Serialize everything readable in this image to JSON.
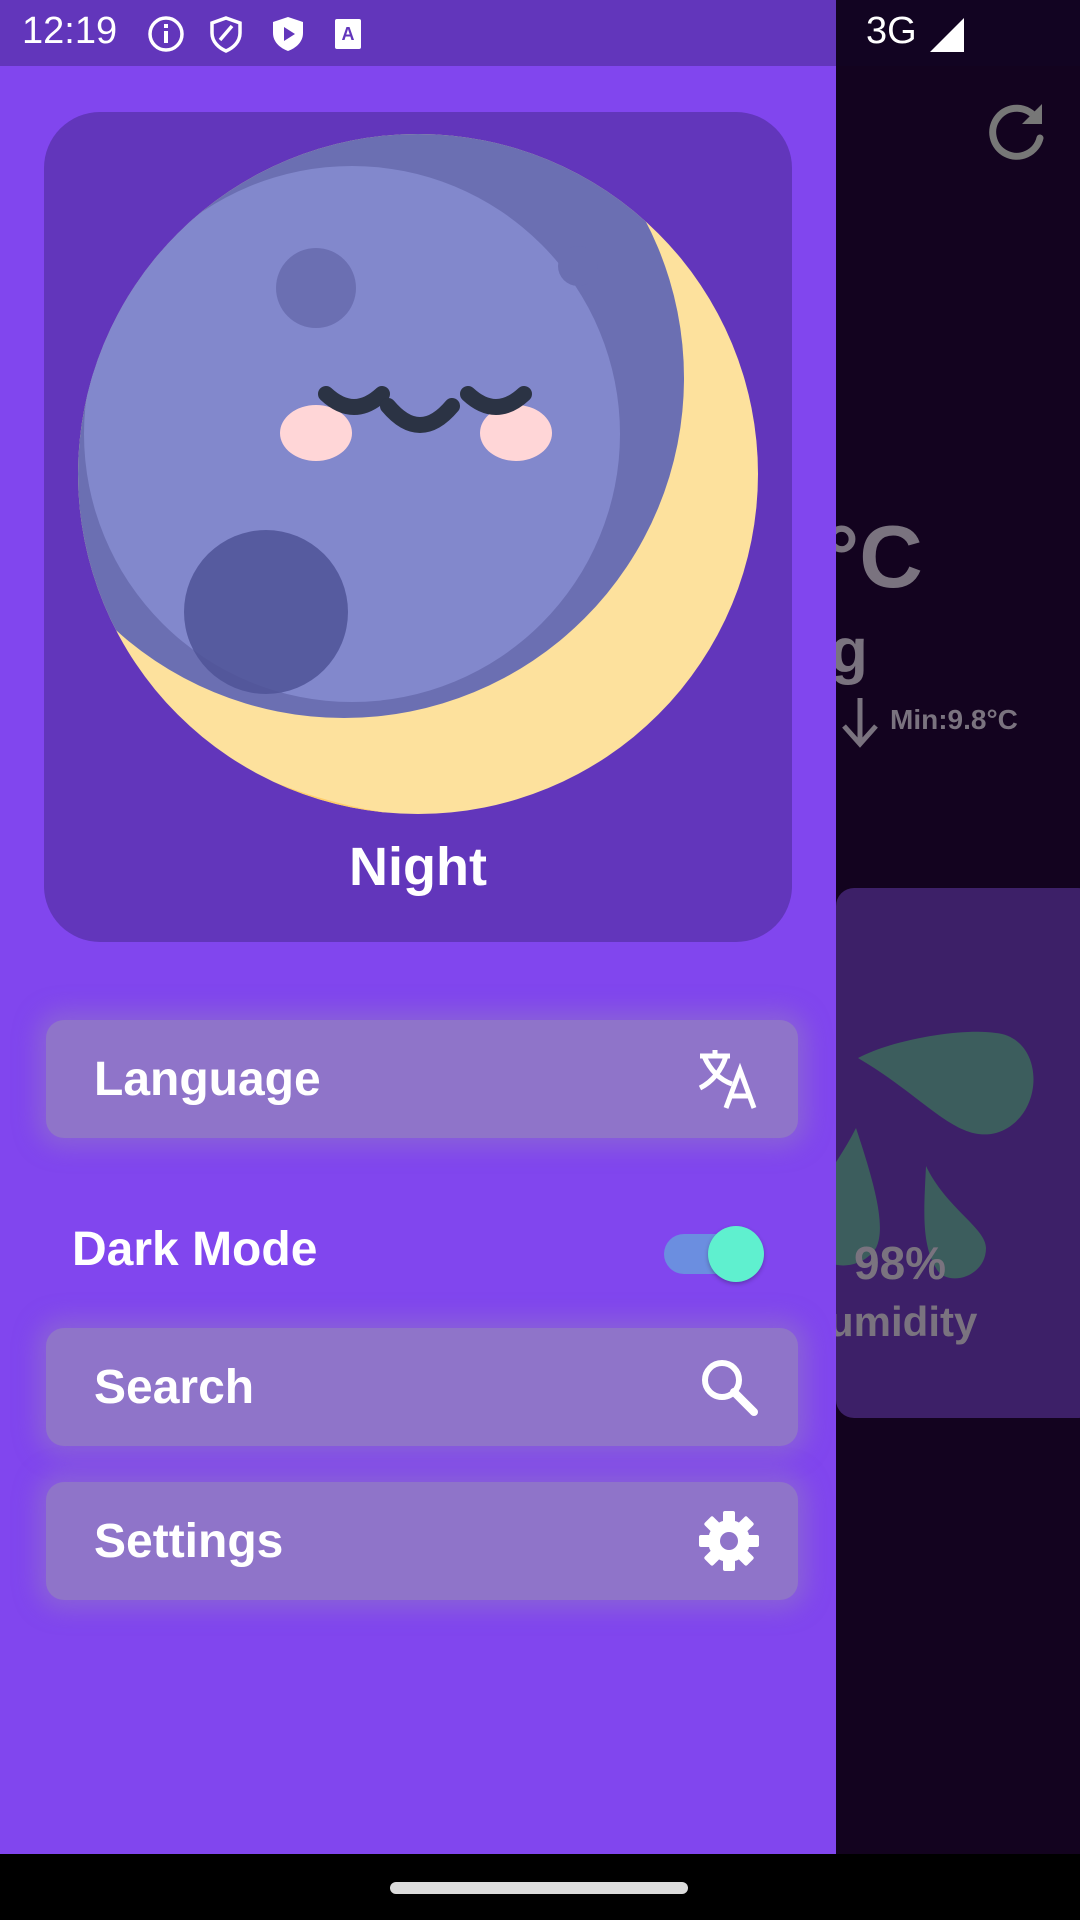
{
  "status_bar": {
    "time": "12:19",
    "icons": [
      "info-icon",
      "shield-icon",
      "play-shield-icon",
      "a-icon"
    ],
    "network": "3G",
    "signal_icon": "signal-icon"
  },
  "drawer": {
    "hero": {
      "title": "Night",
      "image": "sleeping-moon-illustration"
    },
    "menu": [
      {
        "label": "Language",
        "icon": "translate-icon"
      },
      {
        "label": "Search",
        "icon": "search-icon"
      },
      {
        "label": "Settings",
        "icon": "gear-icon"
      }
    ],
    "dark_mode": {
      "label": "Dark Mode",
      "enabled": true
    }
  },
  "background_app": {
    "temperature_partial": "°C",
    "condition_partial": "g",
    "min_temp": "Min:9.8°C",
    "humidity_value": "98%",
    "humidity_label_partial": "umidity",
    "refresh_icon": "refresh-icon"
  },
  "colors": {
    "drawer_bg": "#8146ee",
    "hero_bg": "#6236bb",
    "menu_item_bg": "#8f74c9",
    "toggle_thumb": "#5ff0cf",
    "toggle_track": "#6b8ee0",
    "dim_bg": "#13031f"
  }
}
